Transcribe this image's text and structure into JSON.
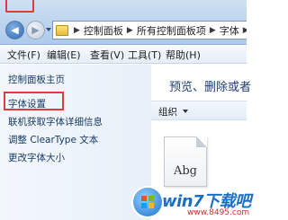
{
  "address_bar": {
    "crumbs": [
      "控制面板",
      "所有控制面板项",
      "字体"
    ]
  },
  "menu": {
    "file": "文件(F)",
    "edit": "编辑(E)",
    "view": "查看(V)",
    "tools": "工具(T)",
    "help": "帮助(H)"
  },
  "left_pane": {
    "home": "控制面板主页",
    "font_settings": "字体设置",
    "online_font_info": "联机获取字体详细信息",
    "cleartype": "调整 ClearType 文本",
    "change_font_size": "更改字体大小"
  },
  "right_pane": {
    "heading": "预览、删除或者",
    "organize": "组织",
    "font_sample": "Abg"
  },
  "watermark": {
    "brand": "win7下载吧",
    "url": "www.8495.com"
  },
  "colors": {
    "highlight": "#e03a3a",
    "link": "#163a66",
    "heading": "#1f3f74"
  }
}
